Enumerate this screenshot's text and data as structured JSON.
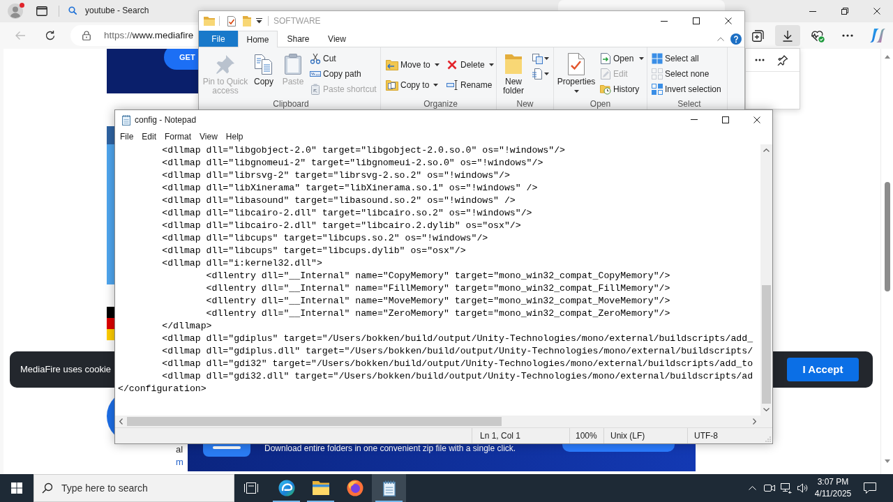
{
  "browser": {
    "tabs": [
      {
        "title": "youtube - Search",
        "selected": false
      },
      {
        "selected": true
      }
    ],
    "back_button": {
      "disabled": true
    },
    "address": {
      "scheme": "https://",
      "rest": "www.mediafire"
    },
    "downloads_open": true,
    "page": {
      "banner_button": "GET",
      "cookie_text": "MediaFire uses cookie",
      "accept_button": "I Accept",
      "fragment_text": "al",
      "fragment_link": "m",
      "promo_text": "Download entire folders in one convenient zip file with a single click."
    }
  },
  "explorer": {
    "title": "SOFTWARE",
    "tabs": [
      {
        "kind": "menu",
        "label": "File",
        "selected": false
      },
      {
        "kind": "tab",
        "label": "Home",
        "selected": true
      },
      {
        "kind": "tab",
        "label": "Share",
        "selected": false
      },
      {
        "kind": "tab",
        "label": "View",
        "selected": false
      }
    ],
    "groups": [
      {
        "label": "Clipboard",
        "columns": [
          {
            "items": [
              {
                "kind": "large",
                "label": "Pin to Quick access",
                "disabled": true
              }
            ]
          },
          {
            "items": [
              {
                "kind": "large",
                "label": "Copy",
                "disabled": false
              }
            ]
          },
          {
            "items": [
              {
                "kind": "large",
                "label": "Paste",
                "disabled": true
              }
            ]
          },
          {
            "items": [
              {
                "kind": "small",
                "label": "Cut",
                "disabled": false
              },
              {
                "kind": "small",
                "label": "Copy path",
                "disabled": false
              },
              {
                "kind": "small",
                "label": "Paste shortcut",
                "disabled": true
              }
            ]
          }
        ]
      },
      {
        "label": "Organize",
        "columns": [
          {
            "items": [
              {
                "kind": "medium-menu",
                "label": "Move to",
                "disabled": false
              },
              {
                "kind": "medium-menu",
                "label": "Copy to",
                "disabled": false
              }
            ]
          },
          {
            "items": [
              {
                "kind": "medium-menu",
                "label": "Delete",
                "disabled": false
              },
              {
                "kind": "medium",
                "label": "Rename",
                "disabled": false
              }
            ]
          }
        ]
      },
      {
        "label": "New",
        "columns": [
          {
            "items": [
              {
                "kind": "large",
                "label": "New folder",
                "disabled": false
              }
            ]
          },
          {
            "items": [
              {
                "kind": "icon-menu",
                "disabled": false
              },
              {
                "kind": "icon-menu",
                "disabled": false
              }
            ]
          }
        ]
      },
      {
        "label": "Open",
        "columns": [
          {
            "items": [
              {
                "kind": "large-menu",
                "label": "Properties",
                "disabled": false
              }
            ]
          },
          {
            "items": [
              {
                "kind": "small-menu",
                "label": "Open",
                "disabled": false
              },
              {
                "kind": "small",
                "label": "Edit",
                "disabled": true
              },
              {
                "kind": "small",
                "label": "History",
                "disabled": false
              }
            ]
          }
        ]
      },
      {
        "label": "Select",
        "columns": [
          {
            "items": [
              {
                "kind": "small",
                "label": "Select all",
                "disabled": false
              },
              {
                "kind": "small",
                "label": "Select none",
                "disabled": false
              },
              {
                "kind": "small",
                "label": "Invert selection",
                "disabled": false
              }
            ]
          }
        ]
      }
    ]
  },
  "notepad": {
    "title": "config - Notepad",
    "menu": [
      "File",
      "Edit",
      "Format",
      "View",
      "Help"
    ],
    "lines": [
      {
        "children": [
          {
            "text": "<dllmap dll=\"libgobject-2.0\" target=\"libgobject-2.0.so.0\" os=\"!windows\"/>"
          },
          {
            "text": "<dllmap dll=\"libgnomeui-2\" target=\"libgnomeui-2.so.0\" os=\"!windows\"/>"
          },
          {
            "text": "<dllmap dll=\"librsvg-2\" target=\"librsvg-2.so.2\" os=\"!windows\"/>"
          },
          {
            "text": "<dllmap dll=\"libXinerama\" target=\"libXinerama.so.1\" os=\"!windows\" />"
          },
          {
            "text": "<dllmap dll=\"libasound\" target=\"libasound.so.2\" os=\"!windows\" />"
          },
          {
            "text": "<dllmap dll=\"libcairo-2.dll\" target=\"libcairo.so.2\" os=\"!windows\"/>"
          },
          {
            "text": "<dllmap dll=\"libcairo-2.dll\" target=\"libcairo.2.dylib\" os=\"osx\"/>"
          },
          {
            "text": "<dllmap dll=\"libcups\" target=\"libcups.so.2\" os=\"!windows\"/>"
          },
          {
            "text": "<dllmap dll=\"libcups\" target=\"libcups.dylib\" os=\"osx\"/>"
          },
          {
            "text": "<dllmap dll=\"i:kernel32.dll\">",
            "children": [
              {
                "text": "<dllentry dll=\"__Internal\" name=\"CopyMemory\" target=\"mono_win32_compat_CopyMemory\"/>"
              },
              {
                "text": "<dllentry dll=\"__Internal\" name=\"FillMemory\" target=\"mono_win32_compat_FillMemory\"/>"
              },
              {
                "text": "<dllentry dll=\"__Internal\" name=\"MoveMemory\" target=\"mono_win32_compat_MoveMemory\"/>"
              },
              {
                "text": "<dllentry dll=\"__Internal\" name=\"ZeroMemory\" target=\"mono_win32_compat_ZeroMemory\"/>"
              }
            ]
          },
          {
            "text": "</dllmap>"
          },
          {
            "text": "<dllmap dll=\"gdiplus\" target=\"/Users/bokken/build/output/Unity-Technologies/mono/external/buildscripts/add_"
          },
          {
            "text": "<dllmap dll=\"gdiplus.dll\" target=\"/Users/bokken/build/output/Unity-Technologies/mono/external/buildscripts/"
          },
          {
            "text": "<dllmap dll=\"gdi32\" target=\"/Users/bokken/build/output/Unity-Technologies/mono/external/buildscripts/add_to"
          },
          {
            "text": "<dllmap dll=\"gdi32.dll\" target=\"/Users/bokken/build/output/Unity-Technologies/mono/external/buildscripts/ad"
          }
        ]
      },
      {
        "text": "</configuration>"
      }
    ],
    "status": [
      "Ln 1, Col 1",
      "100%",
      "Unix (LF)",
      "UTF-8"
    ]
  },
  "taskbar": {
    "search": {
      "placeholder": "Type here to search"
    },
    "apps": [
      {
        "kind": "edge",
        "running": true,
        "selected": false
      },
      {
        "kind": "explorer",
        "running": true,
        "selected": false
      },
      {
        "kind": "firefox",
        "running": false,
        "selected": false
      },
      {
        "kind": "notepad",
        "running": true,
        "selected": true
      }
    ],
    "clock": {
      "time": "3:07 PM",
      "date": "4/11/2025"
    }
  }
}
